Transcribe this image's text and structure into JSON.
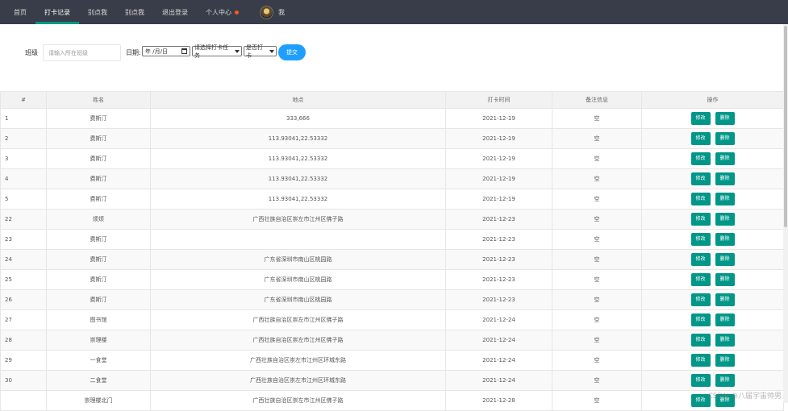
{
  "nav": {
    "items": [
      "首页",
      "打卡记录",
      "别点我",
      "别点我",
      "退出登录",
      "个人中心"
    ],
    "active_index": 1,
    "user_label": "我",
    "accent_color": "#009688",
    "bg_color": "#393d49",
    "badge_color": "#ff5722"
  },
  "filters": {
    "class_label": "班级",
    "class_placeholder": "请输入所在班级",
    "date_label": "日期:",
    "date_value": "年 /月/日",
    "task_select": "请选择打卡任务",
    "checked_select": "是否打卡",
    "submit_label": "提交",
    "submit_color": "#1e9fff"
  },
  "table": {
    "headers": [
      "#",
      "姓名",
      "地点",
      "打卡时间",
      "备注信息",
      "操作"
    ],
    "edit_label": "修改",
    "delete_label": "删除",
    "rows": [
      {
        "id": "1",
        "name": "费斯汀",
        "place": "333,666",
        "time": "2021-12-19",
        "note": "空"
      },
      {
        "id": "2",
        "name": "费斯汀",
        "place": "113.93041,22.53332",
        "time": "2021-12-19",
        "note": "空"
      },
      {
        "id": "3",
        "name": "费斯汀",
        "place": "113.93041,22.53332",
        "time": "2021-12-19",
        "note": "空"
      },
      {
        "id": "4",
        "name": "费斯汀",
        "place": "113.93041,22.53332",
        "time": "2021-12-19",
        "note": "空"
      },
      {
        "id": "5",
        "name": "费斯汀",
        "place": "113.93041,22.53332",
        "time": "2021-12-19",
        "note": "空"
      },
      {
        "id": "22",
        "name": "烦烦",
        "place": "广西壮族自治区崇左市江州区佛子路",
        "time": "2021-12-23",
        "note": "空"
      },
      {
        "id": "23",
        "name": "费斯汀",
        "place": "",
        "time": "2021-12-23",
        "note": "空"
      },
      {
        "id": "24",
        "name": "费斯汀",
        "place": "广东省深圳市南山区桃园路",
        "time": "2021-12-23",
        "note": "空"
      },
      {
        "id": "25",
        "name": "费斯汀",
        "place": "广东省深圳市南山区桃园路",
        "time": "2021-12-23",
        "note": "空"
      },
      {
        "id": "26",
        "name": "费斯汀",
        "place": "广东省深圳市南山区桃园路",
        "time": "2021-12-23",
        "note": "空"
      },
      {
        "id": "27",
        "name": "图书馆",
        "place": "广西壮族自治区崇左市江州区佛子路",
        "time": "2021-12-24",
        "note": "空"
      },
      {
        "id": "28",
        "name": "崇理楼",
        "place": "广西壮族自治区崇左市江州区佛子路",
        "time": "2021-12-24",
        "note": "空"
      },
      {
        "id": "29",
        "name": "一食堂",
        "place": "广西壮族自治区崇左市江州区环城东路",
        "time": "2021-12-24",
        "note": "空"
      },
      {
        "id": "30",
        "name": "二食堂",
        "place": "广西壮族自治区崇左市江州区环城东路",
        "time": "2021-12-24",
        "note": "空"
      },
      {
        "id": "",
        "name": "崇理楼北门",
        "place": "广西壮族自治区崇左市江州区佛子路",
        "time": "2021-12-28",
        "note": "空"
      }
    ]
  },
  "watermark": "CSDN @八届宇宙帅男"
}
